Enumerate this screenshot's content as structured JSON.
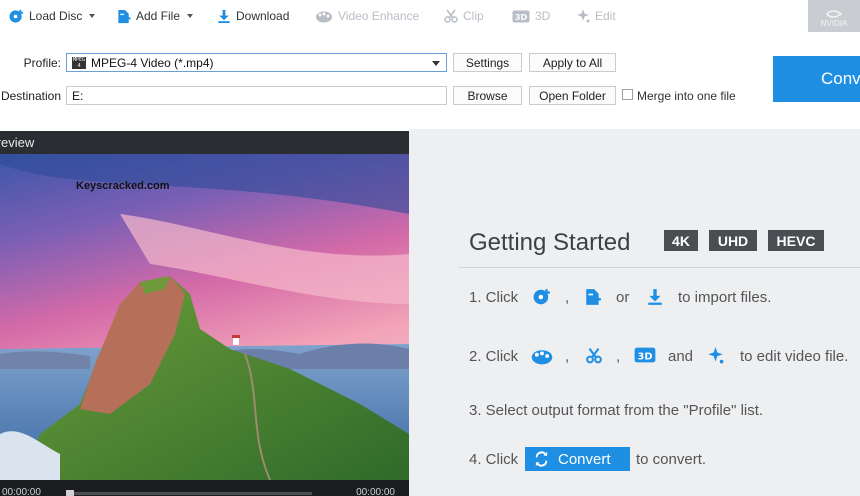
{
  "toolbar": {
    "load_disc": "Load Disc",
    "add_file": "Add File",
    "download": "Download",
    "video_enhance": "Video Enhance",
    "clip": "Clip",
    "three_d": "3D",
    "edit": "Edit",
    "nvidia": "NVIDIA"
  },
  "profile": {
    "label": "Profile:",
    "value": "MPEG-4 Video (*.mp4)",
    "settings": "Settings",
    "apply_all": "Apply to All"
  },
  "destination": {
    "label": "Destination:",
    "value": "E:",
    "browse": "Browse",
    "open_folder": "Open Folder",
    "merge": "Merge into one file",
    "merge_checked": false
  },
  "convert_button": "Convert",
  "preview": {
    "title": "Preview",
    "watermark": "Keyscracked.com",
    "time_current": "00:00:00",
    "time_total": "00:00:00"
  },
  "getting_started": {
    "title": "Getting Started",
    "badges": [
      "4K",
      "UHD",
      "HEVC"
    ],
    "step1": {
      "prefix": "1. Click",
      "sep1": ",",
      "or": "or",
      "suffix": "to import files."
    },
    "step2": {
      "prefix": "2. Click",
      "sep1": ",",
      "sep2": ",",
      "and": "and",
      "suffix": "to edit video file."
    },
    "step3": "3. Select output format from the \"Profile\" list.",
    "step4": {
      "prefix": "4. Click",
      "button": "Convert",
      "suffix": "to convert."
    }
  },
  "colors": {
    "accent": "#1f8fe4",
    "badge": "#4a4d52",
    "panel": "#eeeff1",
    "disabled": "#b8bec6"
  },
  "icons": [
    "load-disc-icon",
    "add-file-icon",
    "download-icon",
    "video-enhance-icon",
    "clip-icon",
    "3d-icon",
    "edit-icon",
    "convert-icon"
  ]
}
